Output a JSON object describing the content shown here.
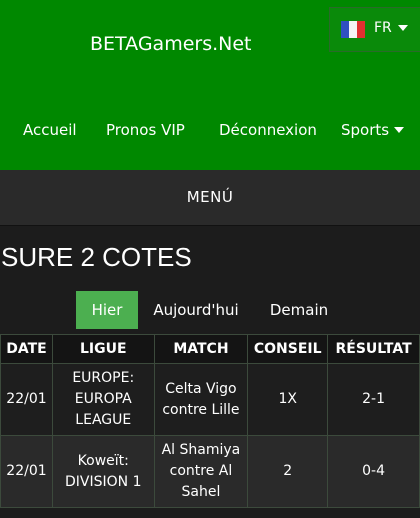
{
  "site": {
    "title": "BETAGamers.Net"
  },
  "language": {
    "code": "FR",
    "flag_colors": [
      "#3050c0",
      "#f4f4f4",
      "#e03030"
    ]
  },
  "nav": {
    "items": [
      "Accueil",
      "Pronos VIP",
      "Déconnexion"
    ],
    "sports_label": "Sports"
  },
  "menu": {
    "label": "MENÚ"
  },
  "section": {
    "title": "SURE 2 COTES"
  },
  "tabs": [
    {
      "label": "Hier",
      "active": true
    },
    {
      "label": "Aujourd'hui",
      "active": false
    },
    {
      "label": "Demain",
      "active": false
    }
  ],
  "table": {
    "headers": [
      "DATE",
      "LIGUE",
      "MATCH",
      "CONSEIL",
      "RÉSULTAT"
    ],
    "rows": [
      [
        "22/01",
        "EUROPE: EUROPA LEAGUE",
        "Celta Vigo contre Lille",
        "1X",
        "2-1"
      ],
      [
        "22/01",
        "Koweït: DIVISION 1",
        "Al Shamiya contre Al Sahel",
        "2",
        "0-4"
      ]
    ]
  },
  "colors": {
    "header_green": "#008800",
    "active_tab": "#4caf50",
    "background": "#1c1c1c"
  }
}
